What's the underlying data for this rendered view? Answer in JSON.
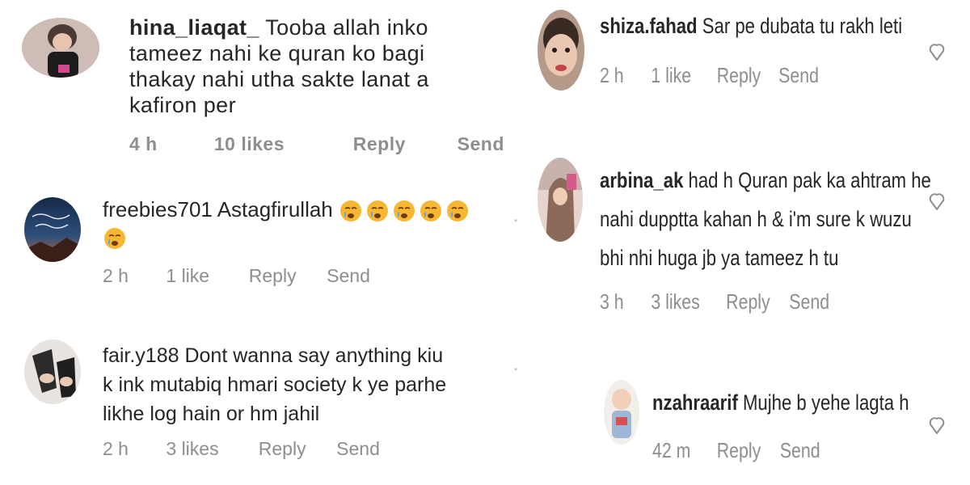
{
  "left_comments": [
    {
      "username": "hina_liaqat_",
      "lines": [
        "Tooba allah inko",
        "tameez nahi ke quran ko bagi",
        "thakay nahi utha sakte lanat a",
        "kafiron per"
      ],
      "time": "4 h",
      "likes": "10 likes",
      "reply": "Reply",
      "send": "Send"
    },
    {
      "username": "freebies701",
      "text": "Astagfirullah",
      "emoji": "crying-face-icon",
      "time": "2 h",
      "likes": "1 like",
      "reply": "Reply",
      "send": "Send"
    },
    {
      "username": "fair.y188",
      "lines": [
        "Dont wanna say anything kiu",
        "k ink mutabiq hmari society k ye parhe",
        "likhe log hain or hm jahil"
      ],
      "time": "2 h",
      "likes": "3 likes",
      "reply": "Reply",
      "send": "Send"
    }
  ],
  "right_comments": [
    {
      "username": "shiza.fahad",
      "text": "Sar pe dubata tu rakh leti",
      "time": "2 h",
      "likes": "1 like",
      "reply": "Reply",
      "send": "Send"
    },
    {
      "username": "arbina_ak",
      "lines": [
        "had h Quran pak ka ahtram he",
        "nahi dupptta kahan h & i'm sure k wuzu",
        "bhi nhi huga jb ya tameez h tu"
      ],
      "time": "3 h",
      "likes": "3 likes",
      "reply": "Reply",
      "send": "Send"
    },
    {
      "username": "nzahraarif",
      "text": "Mujhe b yehe lagta h",
      "time": "42 m",
      "reply": "Reply",
      "send": "Send"
    }
  ],
  "icons": {
    "like": "heart-outline-icon"
  },
  "colors": {
    "text": "#262626",
    "meta": "#8e8e8e",
    "heart": "#8e8e8e"
  }
}
